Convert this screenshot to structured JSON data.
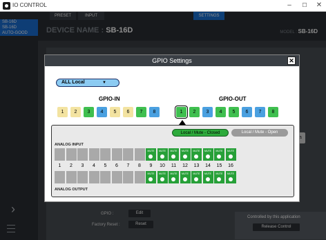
{
  "window": {
    "title": "IO CONTROL",
    "controls": [
      "–",
      "☐",
      "✕"
    ]
  },
  "sidebar": {
    "devices": [
      "SB-16D",
      "SB-16D",
      "AUTO-GOOD"
    ]
  },
  "topbar": {
    "tabs": [
      "PRESET",
      "INPUT",
      "SETTINGS"
    ],
    "device_name_label": "DEVICE NAME :",
    "device_name": "SB-16D",
    "model_label": "MODEL :",
    "model": "SB-16D"
  },
  "background": {
    "gpio_label": "GPIO :",
    "gpio_edit": "Edit",
    "factory_reset_label": "Factory Reset :",
    "factory_reset_btn": "Reset",
    "controlled_text": "Controlled by this application",
    "release_btn": "Release Control"
  },
  "modal": {
    "title": "GPIO Settings",
    "close": "✕",
    "dropdown_value": "ALL Local",
    "gpio_in_label": "GPIO-IN",
    "gpio_out_label": "GPIO-OUT",
    "gpio_in": [
      {
        "n": "1",
        "color": "yellow"
      },
      {
        "n": "2",
        "color": "yellow"
      },
      {
        "n": "3",
        "color": "green"
      },
      {
        "n": "4",
        "color": "blue"
      },
      {
        "n": "5",
        "color": "yellow"
      },
      {
        "n": "6",
        "color": "yellow"
      },
      {
        "n": "7",
        "color": "green"
      },
      {
        "n": "8",
        "color": "blue"
      }
    ],
    "gpio_out": [
      {
        "n": "1",
        "color": "green",
        "selected": true
      },
      {
        "n": "2",
        "color": "green"
      },
      {
        "n": "3",
        "color": "blue"
      },
      {
        "n": "4",
        "color": "green"
      },
      {
        "n": "5",
        "color": "green"
      },
      {
        "n": "6",
        "color": "blue"
      },
      {
        "n": "7",
        "color": "blue"
      },
      {
        "n": "8",
        "color": "green"
      }
    ],
    "mode_closed": "Local / Mute - Closed",
    "mode_open": "Local / Mute - Open",
    "analog_input_label": "ANALOG INPUT",
    "analog_output_label": "ANALOG OUTPUT",
    "mute_label": "MUTE",
    "channels": [
      "1",
      "2",
      "3",
      "4",
      "5",
      "6",
      "7",
      "8",
      "9",
      "10",
      "11",
      "12",
      "13",
      "14",
      "15",
      "16"
    ]
  }
}
